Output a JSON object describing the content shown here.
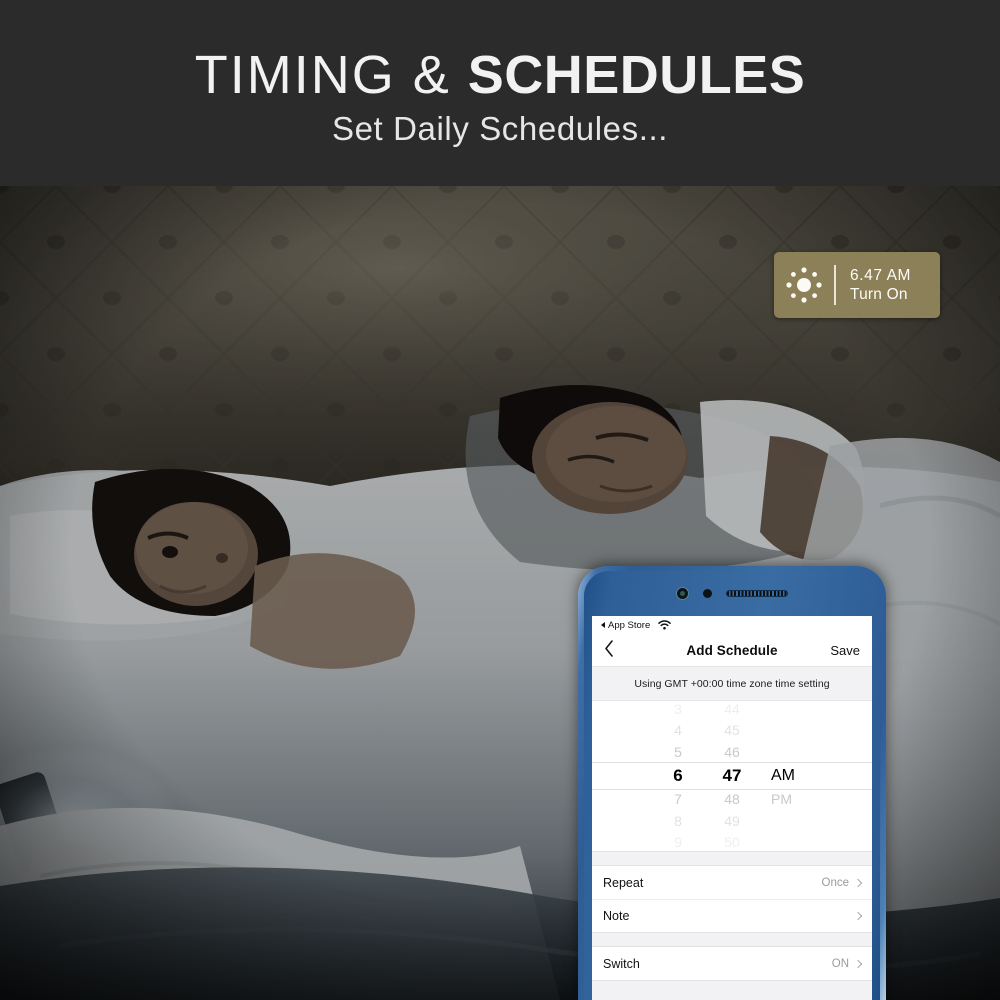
{
  "header": {
    "title_light": "TIMING & ",
    "title_bold": "SCHEDULES",
    "subtitle": "Set Daily Schedules...",
    "background_color": "#2b2b2b",
    "text_color": "#f2f2f2"
  },
  "scene": {
    "description": "Dark bedroom at night, woman awake in bed holding a glowing phone, man sleeping beside her, tufted fabric headboard",
    "alt": "bedroom-night-photo"
  },
  "badge": {
    "icon": "sun-icon",
    "time": "6.47  AM",
    "action": "Turn On",
    "background_color": "#8b8057",
    "text_color": "#fdfcf8"
  },
  "phone": {
    "frame_color": "#3a6ca4",
    "hardware": {
      "camera": "front-camera",
      "sensor": "proximity-sensor",
      "speaker": "earpiece-speaker"
    },
    "status_bar": {
      "back_label": "App Store",
      "wifi_icon": "wifi-icon"
    },
    "nav": {
      "back_icon": "chevron-left-icon",
      "title": "Add Schedule",
      "save_label": "Save"
    },
    "gmt_note": "Using GMT +00:00 time zone time setting",
    "picker": {
      "hours": [
        "3",
        "4",
        "5",
        "6",
        "7",
        "8",
        "9"
      ],
      "minutes": [
        "44",
        "45",
        "46",
        "47",
        "48",
        "49",
        "50"
      ],
      "meridiem": [
        "AM",
        "PM"
      ],
      "selected_hour": "6",
      "selected_minute": "47",
      "selected_meridiem": "AM"
    },
    "rows": [
      {
        "label": "Repeat",
        "value": "Once",
        "chevron": "chevron-right-icon"
      },
      {
        "label": "Note",
        "value": "",
        "chevron": "chevron-right-icon"
      },
      {
        "label": "Switch",
        "value": "ON",
        "chevron": "chevron-right-icon"
      }
    ]
  }
}
